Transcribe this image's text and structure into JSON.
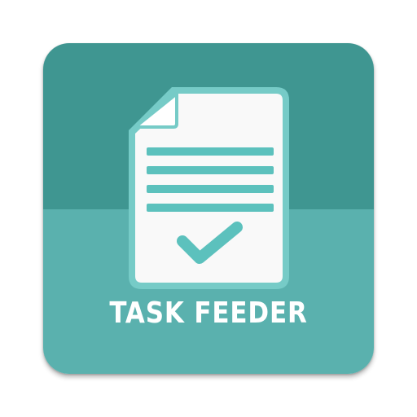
{
  "app": {
    "name": "TASK FEEDER"
  },
  "icon": {
    "document": "document-icon",
    "check": "checkmark-icon"
  },
  "colors": {
    "bg_top": "#3f9691",
    "bg_bottom": "#5ab1ae",
    "doc_border": "#76cbc7",
    "doc_fill": "#f9f9f9",
    "accent": "#5cc1bd",
    "text": "#ffffff"
  }
}
